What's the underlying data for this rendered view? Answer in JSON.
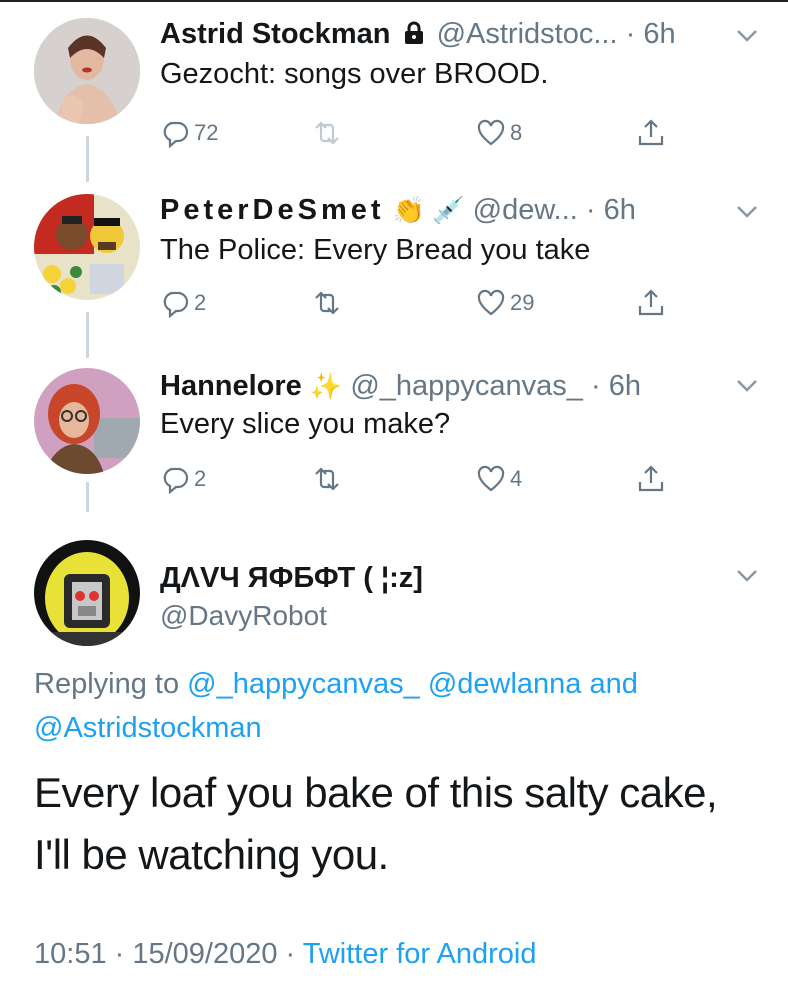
{
  "tweets": [
    {
      "name": "Astrid Stockman",
      "handle": "@Astridstoc...",
      "time": "6h",
      "text": "Gezocht: songs over BROOD.",
      "replies": "72",
      "retweets": "",
      "likes": "8",
      "locked": true
    },
    {
      "name": "PeterDeSmet",
      "handle": "@dew...",
      "time": "6h",
      "text": "The Police: Every Bread you take",
      "replies": "2",
      "retweets": "",
      "likes": "29",
      "emoji": "👏 💉"
    },
    {
      "name": "Hannelore",
      "handle": "@_happycanvas_",
      "time": "6h",
      "text": "Every slice you make?",
      "replies": "2",
      "retweets": "",
      "likes": "4",
      "emoji": "✨"
    }
  ],
  "main": {
    "name": "ДΛVЧ ЯФБФТ ( ¦:z]",
    "handle": "@DavyRobot",
    "replying_prefix": "Replying to",
    "replying_1": "@_happycanvas_",
    "replying_2": "@dewlanna",
    "replying_and": "and",
    "replying_3": "@Astridstockman",
    "text_line1": "Every loaf you bake of this salty cake,",
    "text_line2": "I'll be watching you.",
    "timestamp": "10:51 · 15/09/2020",
    "source": "Twitter for Android"
  },
  "colors": {
    "link": "#1da1f2",
    "secondary": "#657786",
    "line": "#ccd6dd"
  },
  "icons": [
    "lock-icon",
    "reply-icon",
    "retweet-icon",
    "like-icon",
    "share-icon",
    "caret-down-icon"
  ]
}
